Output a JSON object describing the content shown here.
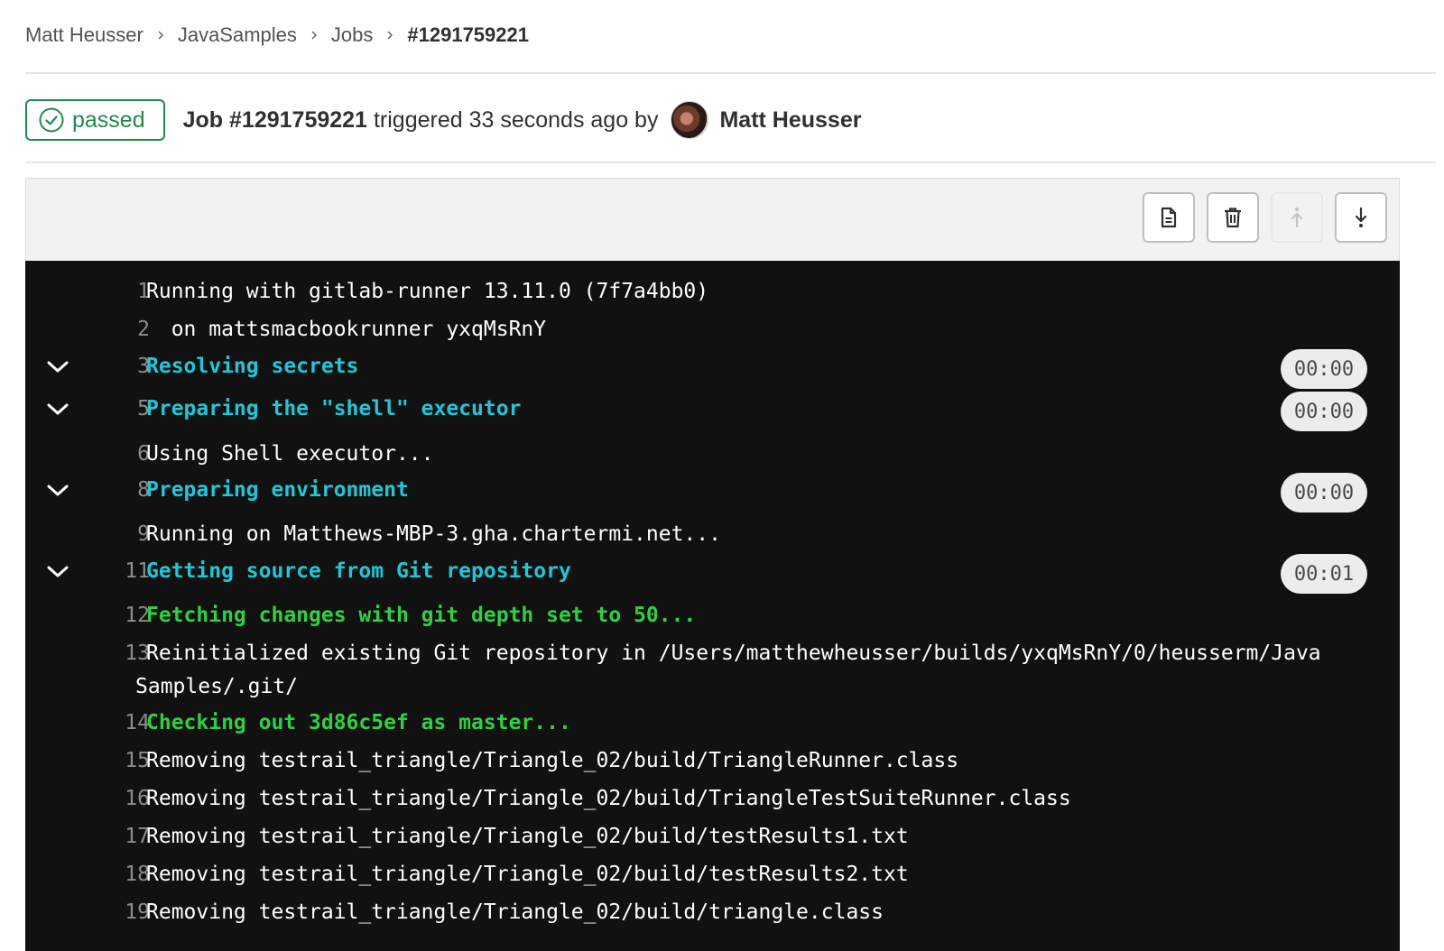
{
  "breadcrumb": {
    "items": [
      "Matt Heusser",
      "JavaSamples",
      "Jobs"
    ],
    "current": "#1291759221"
  },
  "job": {
    "status": "passed",
    "id_label": "Job #1291759221",
    "triggered_text": "triggered 33 seconds ago by",
    "user_name": "Matt Heusser"
  },
  "toolbar": {
    "buttons": [
      {
        "icon": "document-icon",
        "action": "show-complete-raw"
      },
      {
        "icon": "trash-icon",
        "action": "erase-log"
      },
      {
        "icon": "scroll-to-top-icon",
        "action": "scroll-to-top",
        "disabled": true
      },
      {
        "icon": "scroll-to-bottom-icon",
        "action": "scroll-to-bottom"
      }
    ]
  },
  "colors": {
    "success": "#1f8a4c",
    "section_header": "#22c6d6",
    "log_green": "#2fd042",
    "log_background": "#111111"
  },
  "log": {
    "lines": [
      {
        "num": "1",
        "text": "Running with gitlab-runner 13.11.0 (7f7a4bb0)"
      },
      {
        "num": "2",
        "text": "  on mattsmacbookrunner yxqMsRnY"
      },
      {
        "num": "3",
        "text": "Resolving secrets",
        "duration": "00:00"
      },
      {
        "num": "5",
        "text": "Preparing the \"shell\" executor",
        "duration": "00:00"
      },
      {
        "num": "6",
        "text": "Using Shell executor..."
      },
      {
        "num": "8",
        "text": "Preparing environment",
        "duration": "00:00"
      },
      {
        "num": "9",
        "text": "Running on Matthews-MBP-3.gha.chartermi.net..."
      },
      {
        "num": "11",
        "text": "Getting source from Git repository",
        "duration": "00:01"
      },
      {
        "num": "12",
        "text": "Fetching changes with git depth set to 50..."
      },
      {
        "num": "13",
        "text": "Reinitialized existing Git repository in /Users/matthewheusser/builds/yxqMsRnY/0/heusserm/Java",
        "text_cont": "Samples/.git/"
      },
      {
        "num": "14",
        "text": "Checking out 3d86c5ef as master..."
      },
      {
        "num": "15",
        "text": "Removing testrail_triangle/Triangle_02/build/TriangleRunner.class"
      },
      {
        "num": "16",
        "text": "Removing testrail_triangle/Triangle_02/build/TriangleTestSuiteRunner.class"
      },
      {
        "num": "17",
        "text": "Removing testrail_triangle/Triangle_02/build/testResults1.txt"
      },
      {
        "num": "18",
        "text": "Removing testrail_triangle/Triangle_02/build/testResults2.txt"
      },
      {
        "num": "19",
        "text": "Removing testrail_triangle/Triangle_02/build/triangle.class"
      }
    ]
  }
}
